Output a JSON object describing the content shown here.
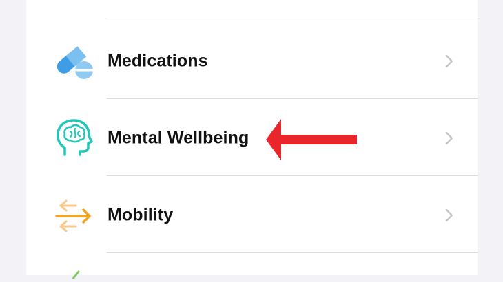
{
  "list": {
    "items": [
      {
        "label": "Medications",
        "icon": "pills-icon"
      },
      {
        "label": "Mental Wellbeing",
        "icon": "brain-head-icon"
      },
      {
        "label": "Mobility",
        "icon": "mobility-arrows-icon"
      }
    ]
  },
  "annotation": {
    "icon": "red-arrow-annotation",
    "color": "#e8262b"
  },
  "colors": {
    "medications": "#4aa3e8",
    "mental_wellbeing": "#22c7b8",
    "mobility": "#f4a41f",
    "chevron": "#c4c4c9"
  }
}
